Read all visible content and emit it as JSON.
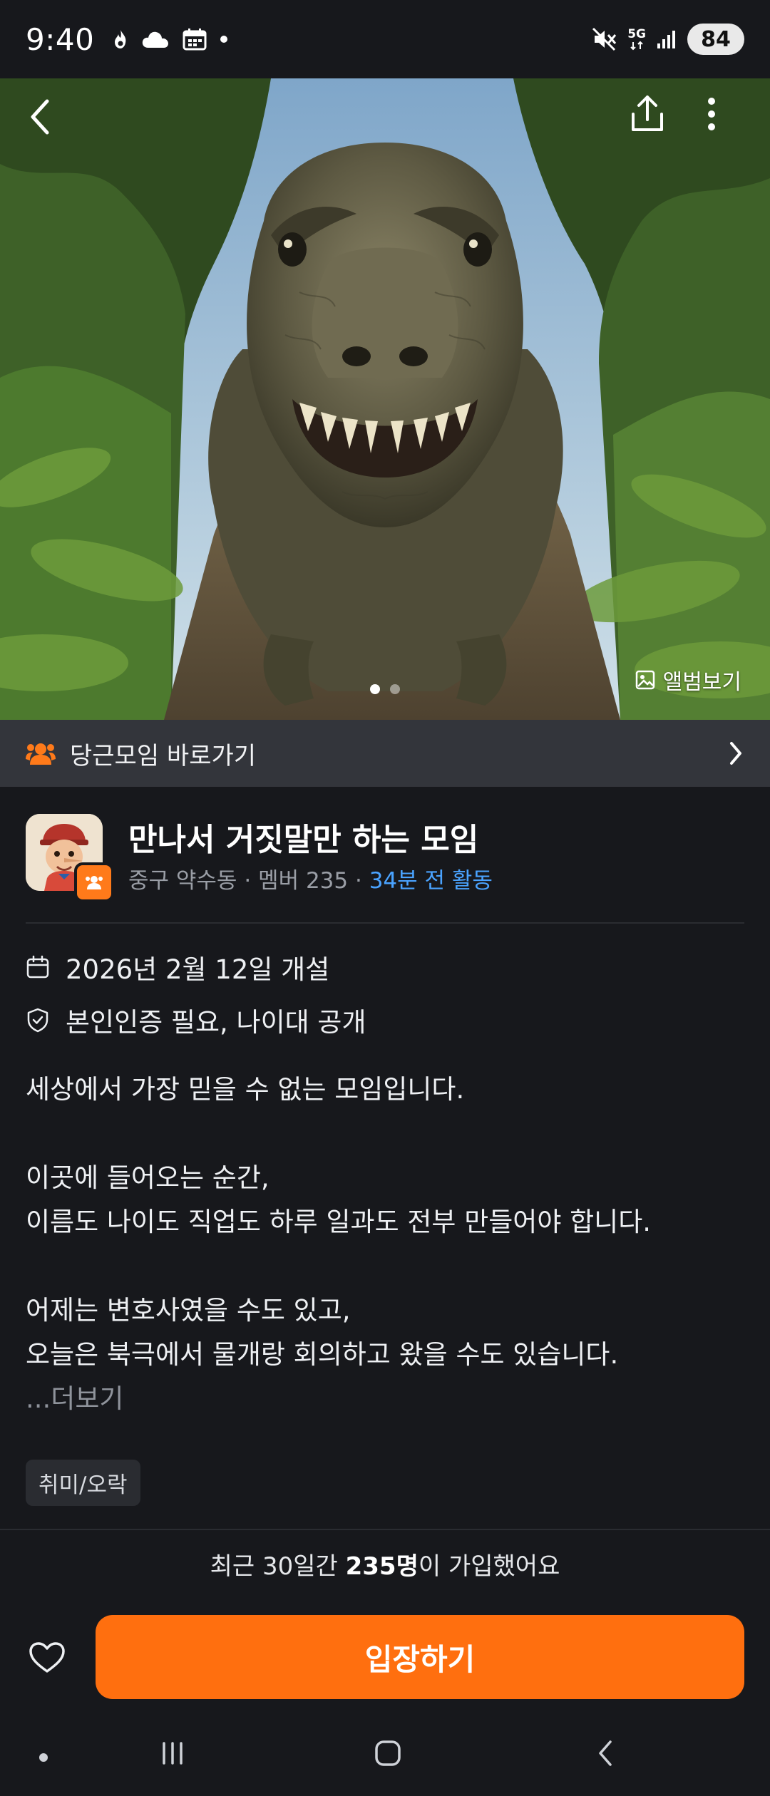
{
  "status_bar": {
    "time": "9:40",
    "left_icons": [
      "flame-icon",
      "cloud-icon",
      "calendar-icon",
      "dot-icon"
    ],
    "right_icons": [
      "mute-icon",
      "5g-icon",
      "signal-icon"
    ],
    "network": "5G",
    "battery": "84"
  },
  "hero": {
    "images": 2,
    "active_index": 0,
    "album_label": "앨범보기"
  },
  "shortcut": {
    "label": "당근모임 바로가기"
  },
  "group": {
    "title": "만나서 거짓말만 하는 모임",
    "location": "중구 약수동",
    "members": "멤버 235",
    "activity": "34분 전 활동",
    "opened": "2026년 2월 12일 개설",
    "requirements": "본인인증 필요, 나이대 공개",
    "description": [
      "세상에서 가장 믿을 수 없는 모임입니다.",
      "",
      "이곳에 들어오는 순간,",
      "이름도 나이도 직업도 하루 일과도 전부 만들어야 합니다.",
      "",
      "어제는 변호사였을 수도 있고,",
      "오늘은 북극에서 물개랑 회의하고 왔을 수도 있습니다."
    ],
    "more_label": "...더보기",
    "tag": "취미/오락"
  },
  "join_info": {
    "prefix": "최근 30일간 ",
    "count": "235명",
    "suffix": "이 가입했어요"
  },
  "actions": {
    "enter_label": "입장하기"
  },
  "colors": {
    "accent": "#ff6f0f",
    "link_blue": "#4aa3ff",
    "background": "#17181c"
  }
}
